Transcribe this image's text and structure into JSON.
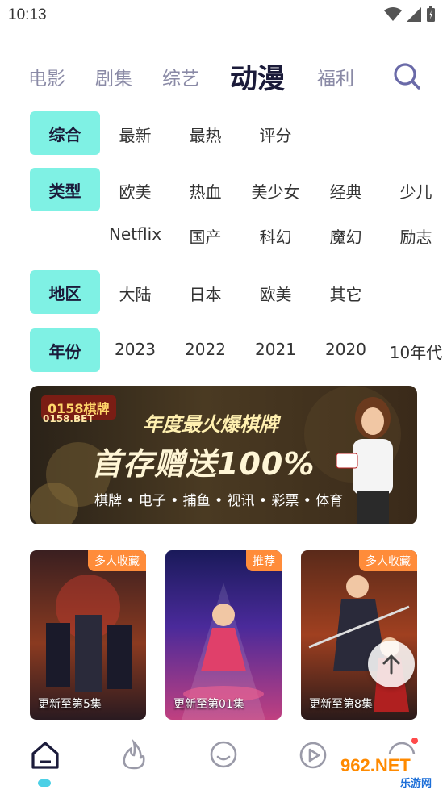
{
  "status_bar": {
    "time": "10:13"
  },
  "top_tabs": [
    {
      "label": "电影",
      "active": false
    },
    {
      "label": "剧集",
      "active": false
    },
    {
      "label": "综艺",
      "active": false
    },
    {
      "label": "动漫",
      "active": true
    },
    {
      "label": "福利",
      "active": false
    }
  ],
  "filters": {
    "sort": {
      "label": "综合",
      "options": [
        "最新",
        "最热",
        "评分"
      ]
    },
    "type": {
      "label": "类型",
      "options_row1": [
        "欧美",
        "热血",
        "美少女",
        "经典",
        "少儿"
      ],
      "options_row2": [
        "Netflix",
        "国产",
        "科幻",
        "魔幻",
        "励志"
      ]
    },
    "region": {
      "label": "地区",
      "options": [
        "大陆",
        "日本",
        "欧美",
        "其它"
      ]
    },
    "year": {
      "label": "年份",
      "options": [
        "2023",
        "2022",
        "2021",
        "2020",
        "10年代"
      ]
    }
  },
  "banner": {
    "logo_text": "0158棋牌",
    "logo_sub": "0158.BET",
    "line1": "年度最火爆棋牌",
    "line2": "首存赠送100%",
    "line3": "棋牌 • 电子 • 捕鱼 • 视讯 • 彩票 • 体育"
  },
  "cards": [
    {
      "badge": "多人收藏",
      "caption": "更新至第5集"
    },
    {
      "badge": "推荐",
      "caption": "更新至第01集"
    },
    {
      "badge": "多人收藏",
      "caption": "更新至第8集"
    }
  ],
  "watermark": {
    "top": "962.NET",
    "bottom": "乐游网"
  }
}
